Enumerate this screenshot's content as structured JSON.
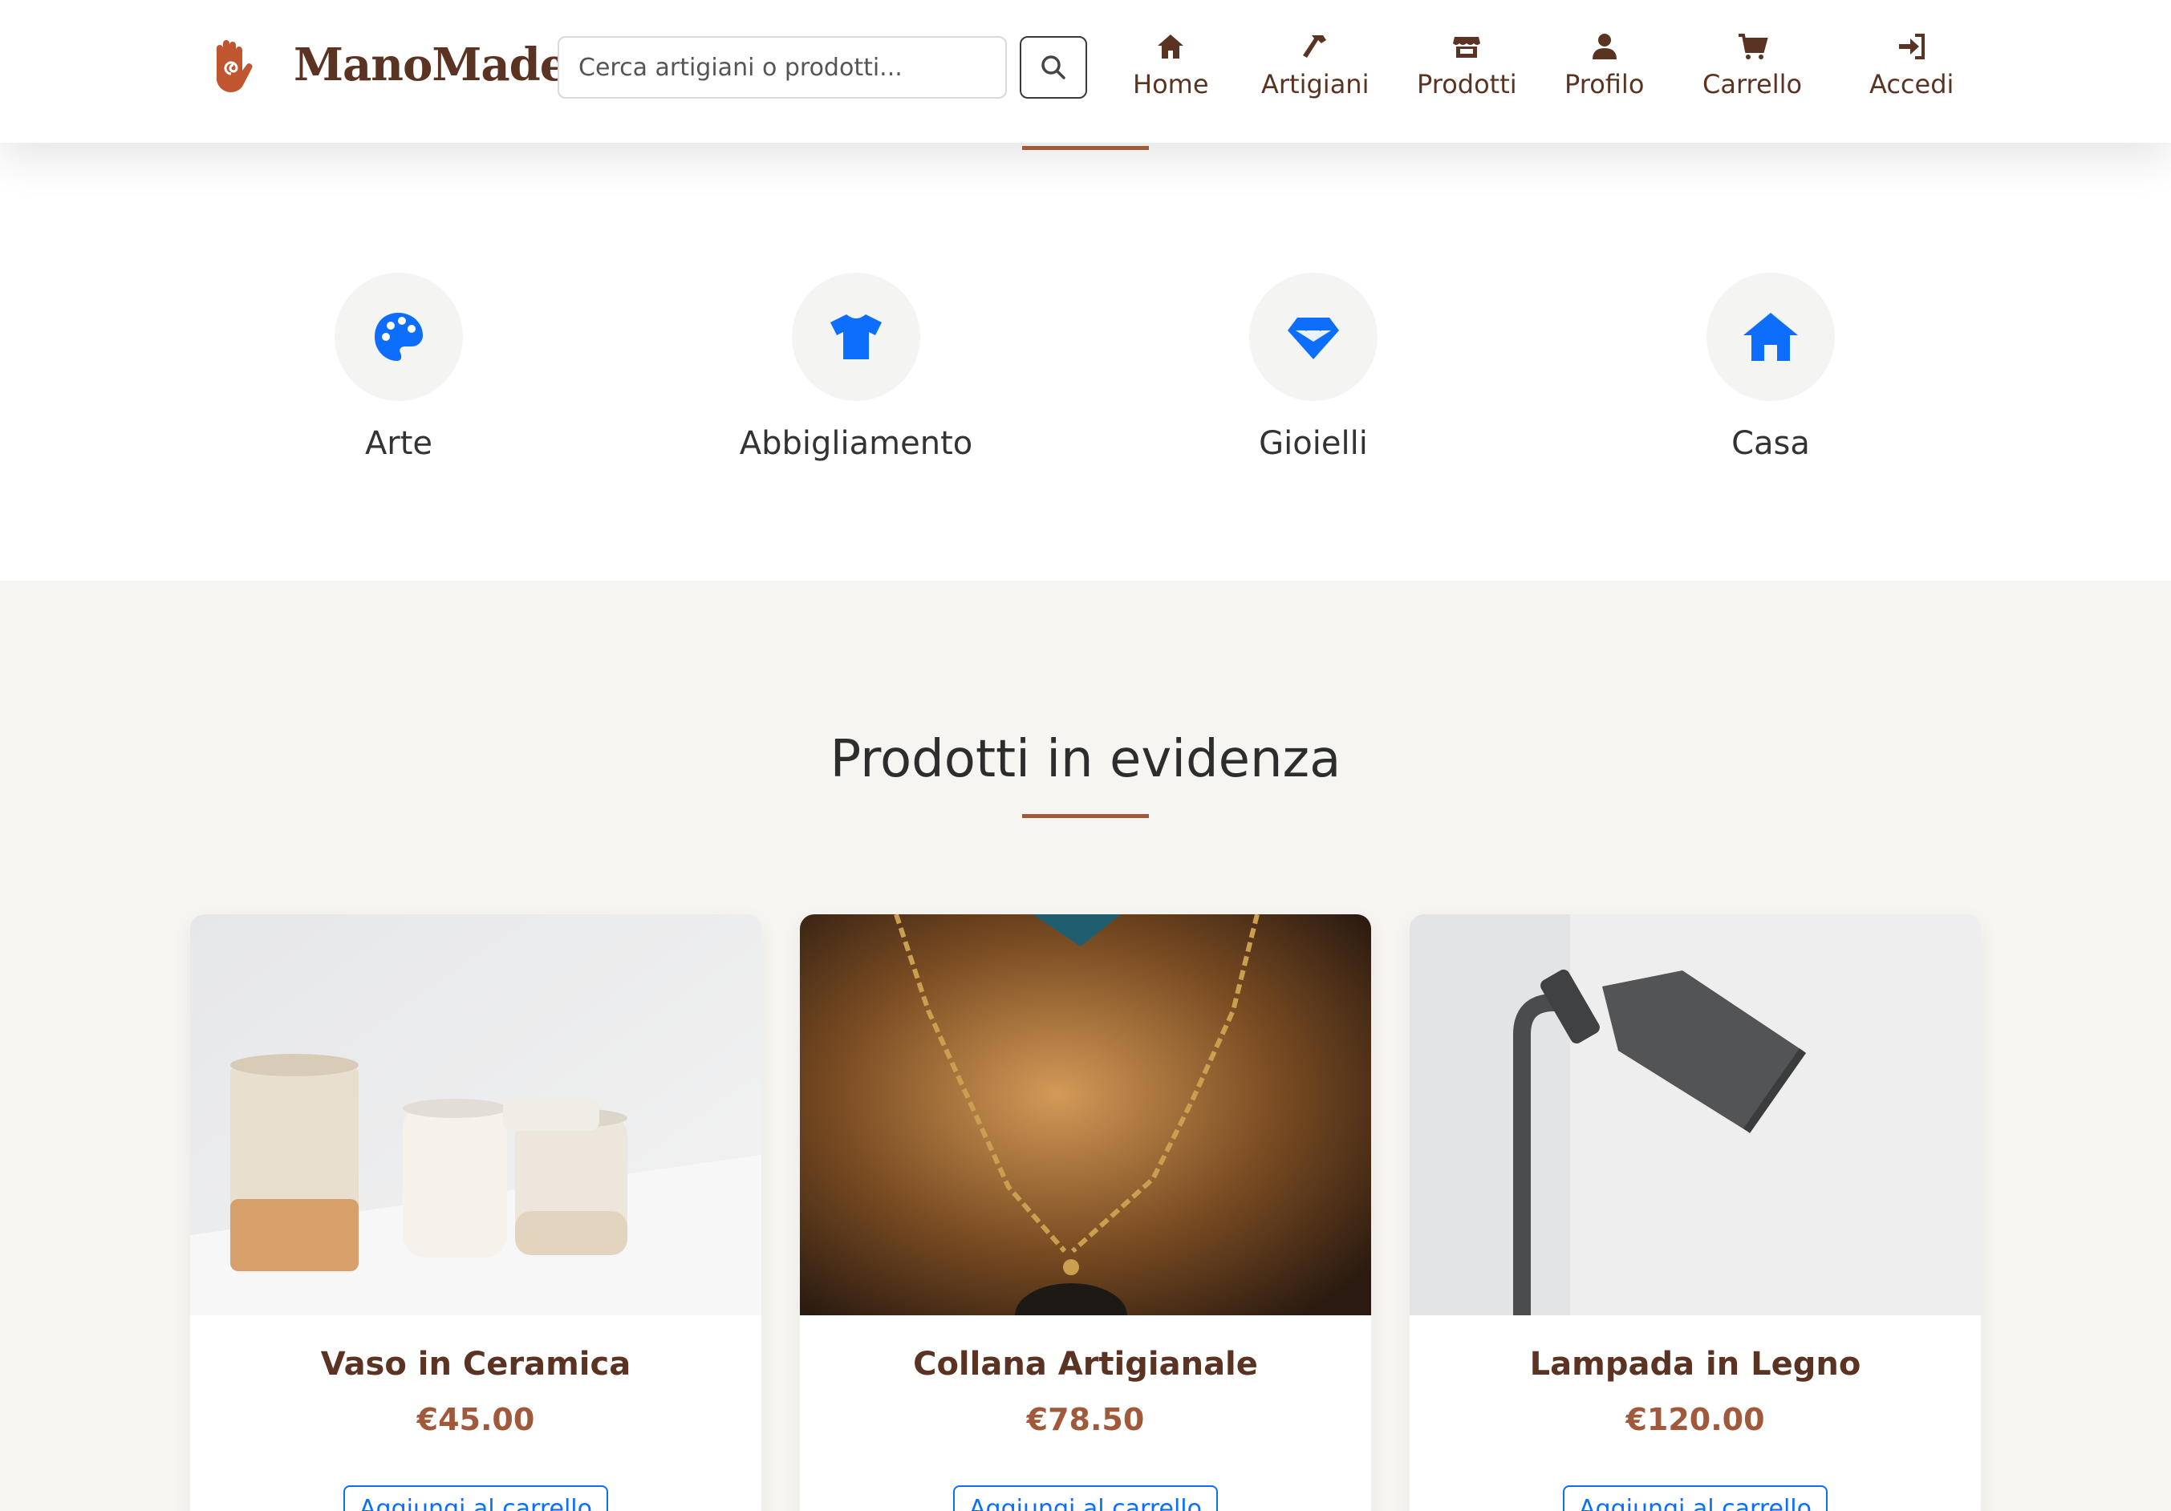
{
  "header": {
    "brand": "ManoMade",
    "search_placeholder": "Cerca artigiani o prodotti...",
    "nav": [
      {
        "label": "Home",
        "icon": "home-icon"
      },
      {
        "label": "Artigiani",
        "icon": "hammer-icon"
      },
      {
        "label": "Prodotti",
        "icon": "store-icon"
      },
      {
        "label": "Profilo",
        "icon": "user-icon"
      },
      {
        "label": "Carrello",
        "icon": "cart-icon"
      },
      {
        "label": "Accedi",
        "icon": "sign-in-icon"
      }
    ]
  },
  "categories": [
    {
      "label": "Arte",
      "icon": "palette-icon"
    },
    {
      "label": "Abbigliamento",
      "icon": "shirt-icon"
    },
    {
      "label": "Gioielli",
      "icon": "gem-icon"
    },
    {
      "label": "Casa",
      "icon": "house-icon"
    }
  ],
  "featured": {
    "title": "Prodotti in evidenza",
    "products": [
      {
        "name": "Vaso in Ceramica",
        "price": "€45.00",
        "button": "Aggiungi al carrello"
      },
      {
        "name": "Collana Artigianale",
        "price": "€78.50",
        "button": "Aggiungi al carrello"
      },
      {
        "name": "Lampada in Legno",
        "price": "€120.00",
        "button": "Aggiungi al carrello"
      }
    ]
  },
  "colors": {
    "brand_brown": "#5a3322",
    "accent_copper": "#a0593a",
    "icon_blue": "#0d6efd"
  }
}
